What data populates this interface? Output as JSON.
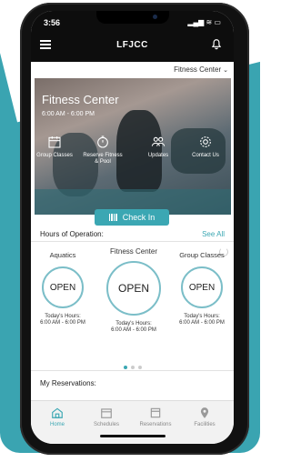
{
  "status": {
    "time": "3:56",
    "icons": "▂▄▆ ≋ ▭"
  },
  "header": {
    "title": "LFJCC"
  },
  "dropdown": {
    "selected": "Fitness Center"
  },
  "hero": {
    "title": "Fitness Center",
    "hours": "6:00 AM - 6:00 PM",
    "quick_links": [
      {
        "label": "Group Classes"
      },
      {
        "label": "Reserve Fitness & Pool"
      },
      {
        "label": "Updates"
      },
      {
        "label": "Contact Us"
      }
    ]
  },
  "checkin": {
    "label": "Check In"
  },
  "hours_section": {
    "heading": "Hours of Operation:",
    "see_all": "See All"
  },
  "facilities": [
    {
      "name": "Aquatics",
      "status": "OPEN",
      "hours_label": "Today's Hours:",
      "hours": "6:00 AM - 6:00 PM"
    },
    {
      "name": "Fitness Center",
      "status": "OPEN",
      "hours_label": "Today's Hours:",
      "hours": "6:00 AM - 6:00 PM"
    },
    {
      "name": "Group Classes",
      "status": "OPEN",
      "hours_label": "Today's Hours:",
      "hours": "6:00 AM - 6:00 PM"
    }
  ],
  "reservations": {
    "heading": "My Reservations:"
  },
  "tabs": [
    {
      "label": "Home"
    },
    {
      "label": "Schedules"
    },
    {
      "label": "Reservations"
    },
    {
      "label": "Facilities"
    }
  ],
  "colors": {
    "accent": "#3ba7b3",
    "background_teal": "#3aa4b1"
  }
}
